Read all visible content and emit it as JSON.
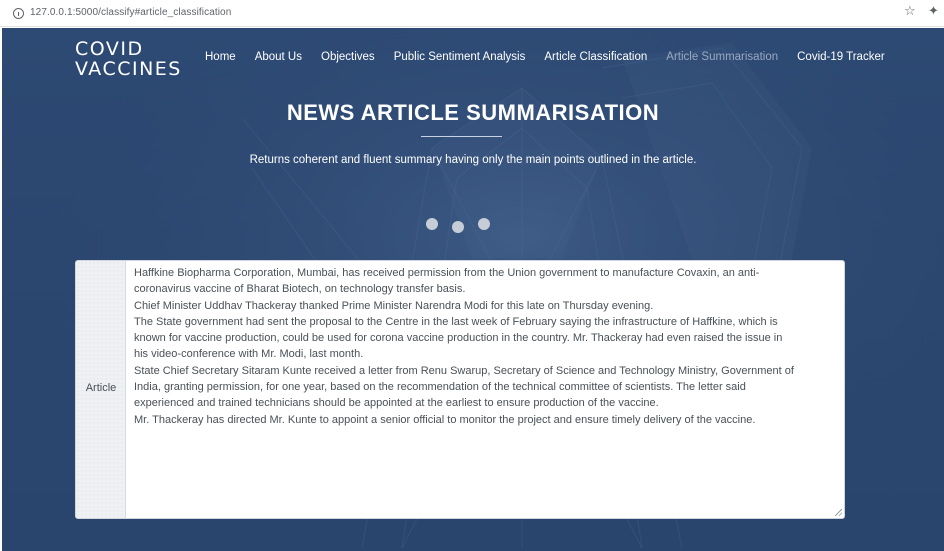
{
  "browser": {
    "url": "127.0.0.1:5000/classify#article_classification",
    "info_icon": "info-icon",
    "star_icon": "star-icon",
    "extension_icon": "puzzle-icon"
  },
  "header": {
    "logo_line1": "COVID",
    "logo_line2": "VACCINES",
    "nav": [
      {
        "label": "Home",
        "active": false
      },
      {
        "label": "About Us",
        "active": false
      },
      {
        "label": "Objectives",
        "active": false
      },
      {
        "label": "Public Sentiment Analysis",
        "active": false
      },
      {
        "label": "Article Classification",
        "active": false
      },
      {
        "label": "Article Summarisation",
        "active": true
      },
      {
        "label": "Covid-19 Tracker",
        "active": false
      }
    ]
  },
  "hero": {
    "title": "NEWS ARTICLE SUMMARISATION",
    "subtitle": "Returns coherent and fluent summary having only the main points outlined in the article."
  },
  "loader": {
    "dot_count": 3
  },
  "article": {
    "label": "Article",
    "text": "Haffkine Biopharma Corporation, Mumbai, has received permission from the Union government to manufacture Covaxin, an anti-\ncoronavirus vaccine of Bharat Biotech, on technology transfer basis.\nChief Minister Uddhav Thackeray thanked Prime Minister Narendra Modi for this late on Thursday evening.\nThe State government had sent the proposal to the Centre in the last week of February saying the infrastructure of Haffkine, which is\nknown for vaccine production, could be used for corona vaccine production in the country. Mr. Thackeray had even raised the issue in\nhis video-conference with Mr. Modi, last month.\nState Chief Secretary Sitaram Kunte received a letter from Renu Swarup, Secretary of Science and Technology Ministry, Government of\nIndia, granting permission, for one year, based on the recommendation of the technical committee of scientists. The letter said\nexperienced and trained technicians should be appointed at the earliest to ensure production of the vaccine.\nMr. Thackeray has directed Mr. Kunte to appoint a senior official to monitor the project and ensure timely delivery of the vaccine."
  }
}
